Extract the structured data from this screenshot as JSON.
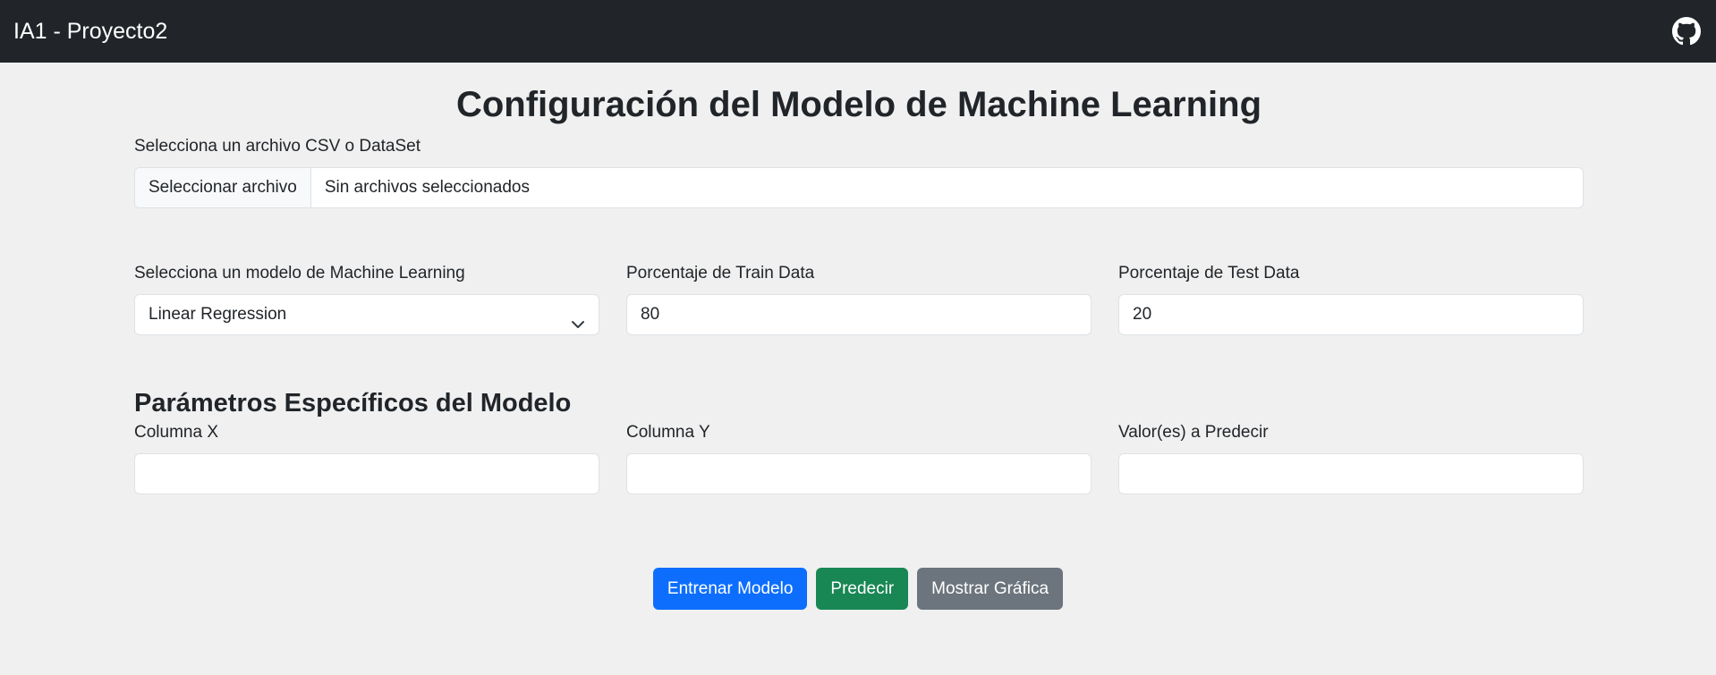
{
  "navbar": {
    "brand": "IA1 - Proyecto2",
    "github_icon": "github-icon",
    "background": "#212529"
  },
  "main": {
    "title": "Configuración del Modelo de Machine Learning",
    "file": {
      "label": "Selecciona un archivo CSV o DataSet",
      "button_label": "Seleccionar archivo",
      "status": "Sin archivos seleccionados"
    },
    "model": {
      "label": "Selecciona un modelo de Machine Learning",
      "selected": "Linear Regression",
      "icon": "chevron-down-icon"
    },
    "train": {
      "label": "Porcentaje de Train Data",
      "value": "80"
    },
    "test": {
      "label": "Porcentaje de Test Data",
      "value": "20"
    },
    "params": {
      "title": "Parámetros Específicos del Modelo",
      "col_x_label": "Columna X",
      "col_x_value": "",
      "col_y_label": "Columna Y",
      "col_y_value": "",
      "predict_label": "Valor(es) a Predecir",
      "predict_value": ""
    }
  },
  "actions": {
    "train_label": "Entrenar Modelo",
    "predict_label": "Predecir",
    "chart_label": "Mostrar Gráfica",
    "colors": {
      "train": "#0d6efd",
      "predict": "#198754",
      "chart": "#6c757d"
    }
  }
}
